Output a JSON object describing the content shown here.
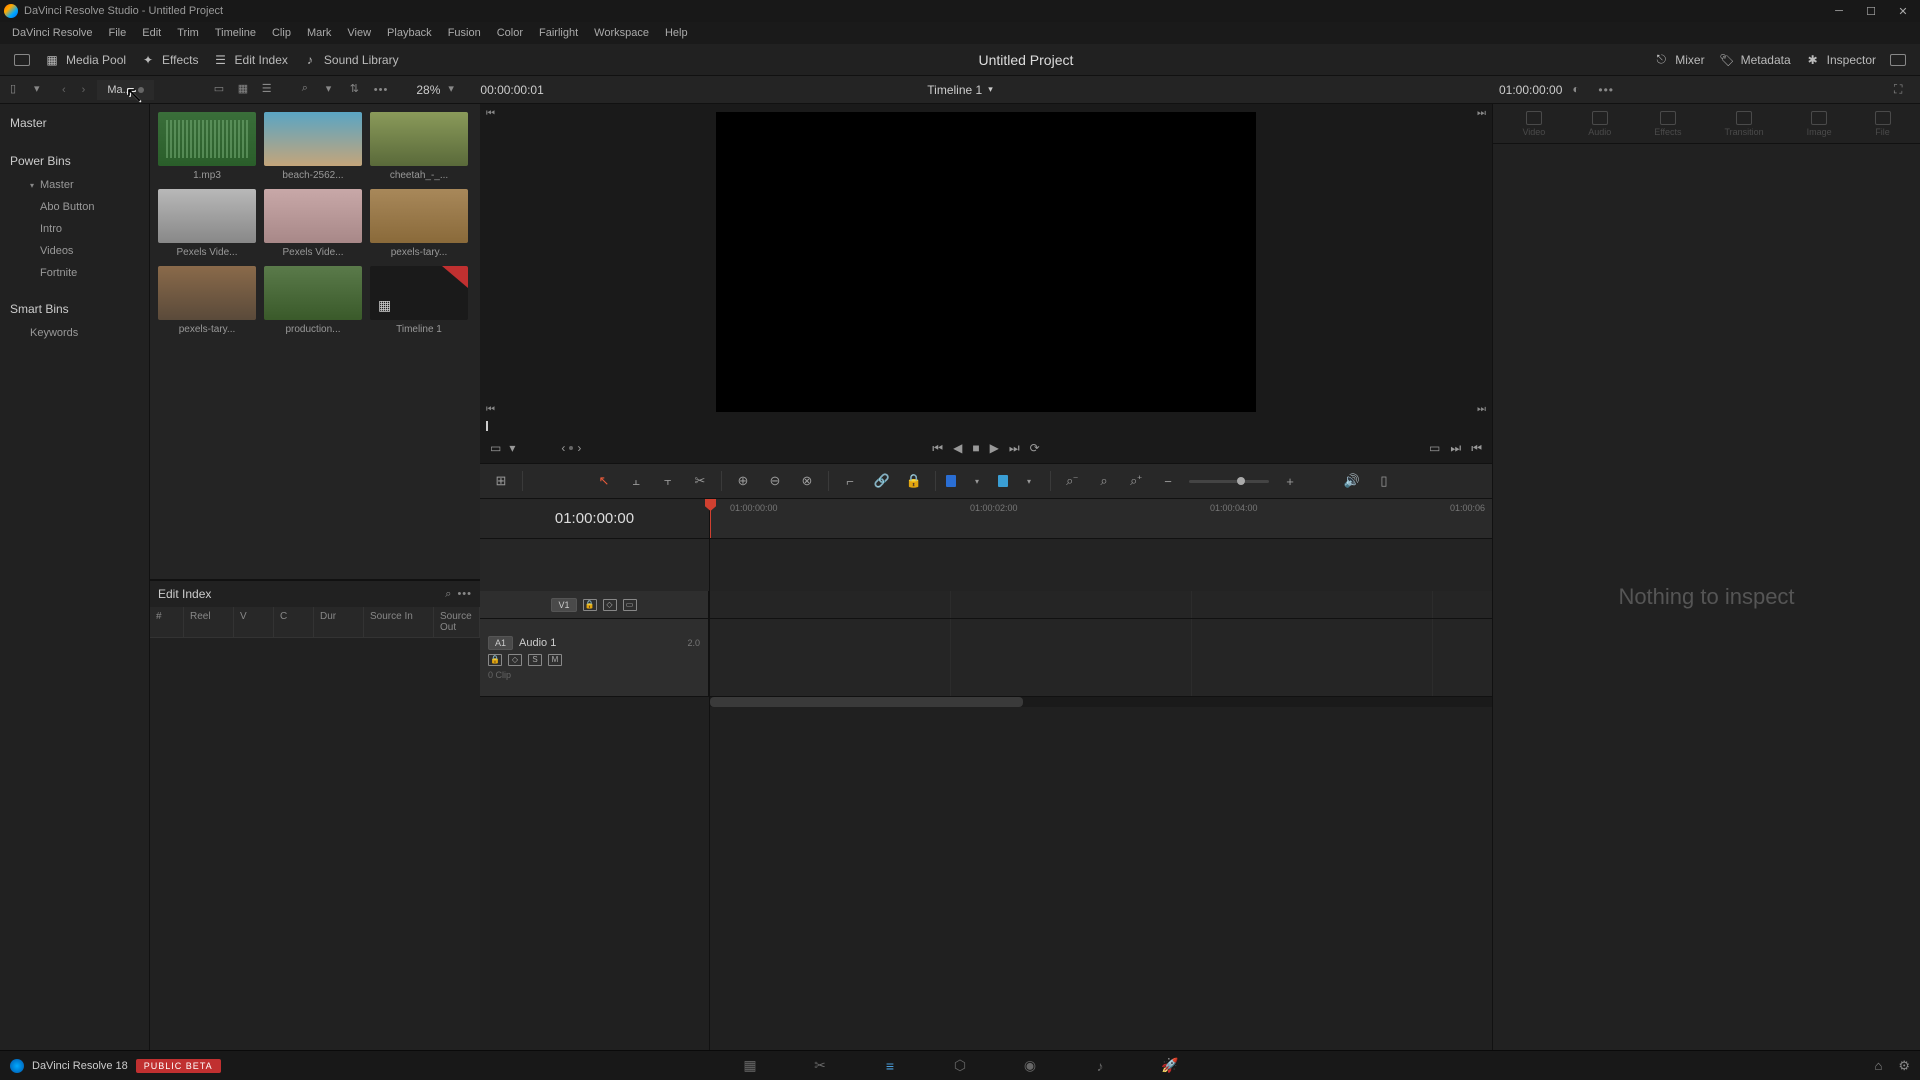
{
  "title_bar": {
    "text": "DaVinci Resolve Studio - Untitled Project"
  },
  "menu": [
    "DaVinci Resolve",
    "File",
    "Edit",
    "Trim",
    "Timeline",
    "Clip",
    "Mark",
    "View",
    "Playback",
    "Fusion",
    "Color",
    "Fairlight",
    "Workspace",
    "Help"
  ],
  "toolbar": {
    "media_pool": "Media Pool",
    "effects": "Effects",
    "edit_index": "Edit Index",
    "sound_library": "Sound Library",
    "project_title": "Untitled Project",
    "mixer": "Mixer",
    "metadata": "Metadata",
    "inspector": "Inspector"
  },
  "sec_bar": {
    "breadcrumb": "Ma...",
    "zoom_percent": "28%",
    "src_timecode": "00:00:00:01",
    "timeline_name": "Timeline 1",
    "rec_timecode": "01:00:00:00"
  },
  "bins": {
    "master": "Master",
    "power_bins": "Power Bins",
    "pb_master": "Master",
    "pb_items": [
      "Abo Button",
      "Intro",
      "Videos",
      "Fortnite"
    ],
    "smart_bins": "Smart Bins",
    "sb_items": [
      "Keywords"
    ]
  },
  "clips": [
    {
      "label": "1.mp3",
      "style": "audio"
    },
    {
      "label": "beach-2562...",
      "style": "beach"
    },
    {
      "label": "cheetah_-_...",
      "style": "cheetah"
    },
    {
      "label": "Pexels Vide...",
      "style": "pexels1"
    },
    {
      "label": "Pexels Vide...",
      "style": "pexels2"
    },
    {
      "label": "pexels-tary...",
      "style": "pexels3"
    },
    {
      "label": "pexels-tary...",
      "style": "pexels4"
    },
    {
      "label": "production...",
      "style": "prod"
    },
    {
      "label": "Timeline 1",
      "style": "timeline"
    }
  ],
  "edit_index": {
    "title": "Edit Index",
    "cols": [
      "#",
      "Reel",
      "V",
      "C",
      "Dur",
      "Source In",
      "Source Out"
    ]
  },
  "timeline": {
    "timecode": "01:00:00:00",
    "ruler": [
      "01:00:00:00",
      "01:00:02:00",
      "01:00:04:00",
      "01:00:06"
    ],
    "v1": "V1",
    "a1_badge": "A1",
    "a1_name": "Audio 1",
    "a1_val": "2.0",
    "a1_solo": "S",
    "a1_mute": "M",
    "clip_count": "0 Clip"
  },
  "inspector": {
    "tabs": [
      "Video",
      "Audio",
      "Effects",
      "Transition",
      "Image",
      "File"
    ],
    "empty": "Nothing to inspect"
  },
  "bottom": {
    "label": "DaVinci Resolve 18",
    "badge": "PUBLIC BETA"
  }
}
